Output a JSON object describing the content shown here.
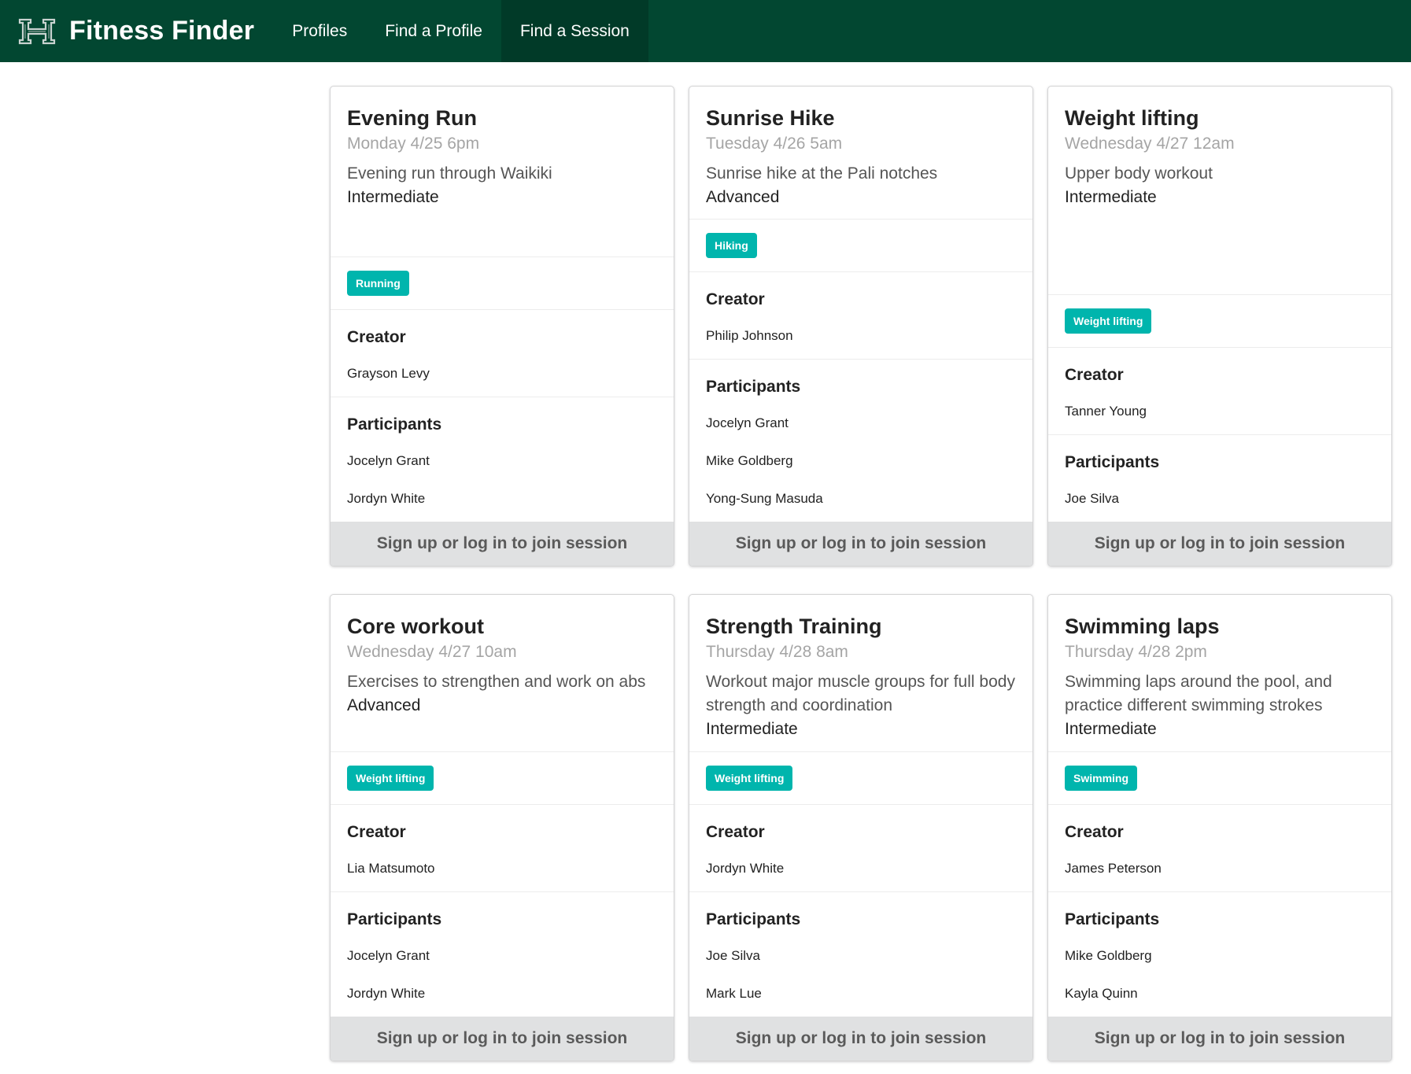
{
  "nav": {
    "brand": "Fitness Finder",
    "items": [
      "Profiles",
      "Find a Profile",
      "Find a Session"
    ]
  },
  "labels": {
    "creator": "Creator",
    "participants": "Participants",
    "join": "Sign up or log in to join session"
  },
  "colors": {
    "navbar": "#024731",
    "tag": "#00b5ad",
    "button": "#e0e1e2"
  },
  "sessions": [
    {
      "title": "Evening Run",
      "time": "Monday 4/25 6pm",
      "description": "Evening run through Waikiki",
      "level": "Intermediate",
      "tag": "Running",
      "creator": "Grayson Levy",
      "participants": [
        "Jocelyn Grant",
        "Jordyn White"
      ]
    },
    {
      "title": "Sunrise Hike",
      "time": "Tuesday 4/26 5am",
      "description": "Sunrise hike at the Pali notches",
      "level": "Advanced",
      "tag": "Hiking",
      "creator": "Philip Johnson",
      "participants": [
        "Jocelyn Grant",
        "Mike Goldberg",
        "Yong-Sung Masuda"
      ]
    },
    {
      "title": "Weight lifting",
      "time": "Wednesday 4/27 12am",
      "description": "Upper body workout",
      "level": "Intermediate",
      "tag": "Weight lifting",
      "creator": "Tanner Young",
      "participants": [
        "Joe Silva"
      ]
    },
    {
      "title": "Core workout",
      "time": "Wednesday 4/27 10am",
      "description": "Exercises to strengthen and work on abs",
      "level": "Advanced",
      "tag": "Weight lifting",
      "creator": "Lia Matsumoto",
      "participants": [
        "Jocelyn Grant",
        "Jordyn White"
      ]
    },
    {
      "title": "Strength Training",
      "time": "Thursday 4/28 8am",
      "description": "Workout major muscle groups for full body strength and coordination",
      "level": "Intermediate",
      "tag": "Weight lifting",
      "creator": "Jordyn White",
      "participants": [
        "Joe Silva",
        "Mark Lue"
      ]
    },
    {
      "title": "Swimming laps",
      "time": "Thursday 4/28 2pm",
      "description": "Swimming laps around the pool, and practice different swimming strokes",
      "level": "Intermediate",
      "tag": "Swimming",
      "creator": "James Peterson",
      "participants": [
        "Mike Goldberg",
        "Kayla Quinn"
      ]
    }
  ]
}
